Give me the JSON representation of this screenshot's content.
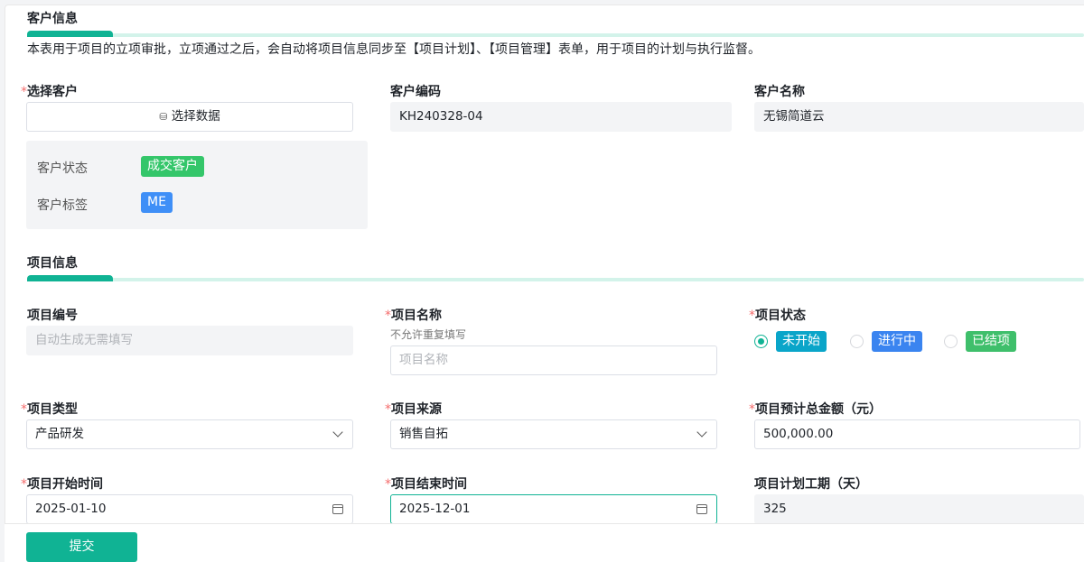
{
  "customer_section": {
    "title": "客户信息",
    "description": "本表用于项目的立项审批，立项通过之后，会自动将项目信息同步至【项目计划】、【项目管理】表单，用于项目的计划与执行监督。",
    "select_customer": {
      "label": "选择客户",
      "button": "选择数据"
    },
    "status_label": "客户状态",
    "status_value": "成交客户",
    "tag_label": "客户标签",
    "tag_value": "ME",
    "code": {
      "label": "客户编码",
      "value": "KH240328-04"
    },
    "name": {
      "label": "客户名称",
      "value": "无锡简道云"
    }
  },
  "project_section": {
    "title": "项目信息",
    "number": {
      "label": "项目编号",
      "placeholder": "自动生成无需填写"
    },
    "name": {
      "label": "项目名称",
      "hint": "不允许重复填写",
      "placeholder": "项目名称"
    },
    "status": {
      "label": "项目状态",
      "options": [
        {
          "label": "未开始",
          "color": "#0aa5c9",
          "selected": true
        },
        {
          "label": "进行中",
          "color": "#3a84f0",
          "selected": false
        },
        {
          "label": "已结项",
          "color": "#3fbf6b",
          "selected": false
        }
      ]
    },
    "type": {
      "label": "项目类型",
      "value": "产品研发"
    },
    "source": {
      "label": "项目来源",
      "value": "销售自拓"
    },
    "budget": {
      "label": "项目预计总金额（元）",
      "value": "500,000.00"
    },
    "start": {
      "label": "项目开始时间",
      "value": "2025-01-10"
    },
    "end": {
      "label": "项目结束时间",
      "value": "2025-12-01"
    },
    "duration": {
      "label": "项目计划工期（天）",
      "value": "325"
    }
  },
  "footer": {
    "submit": "提交"
  },
  "required_mark": "*"
}
